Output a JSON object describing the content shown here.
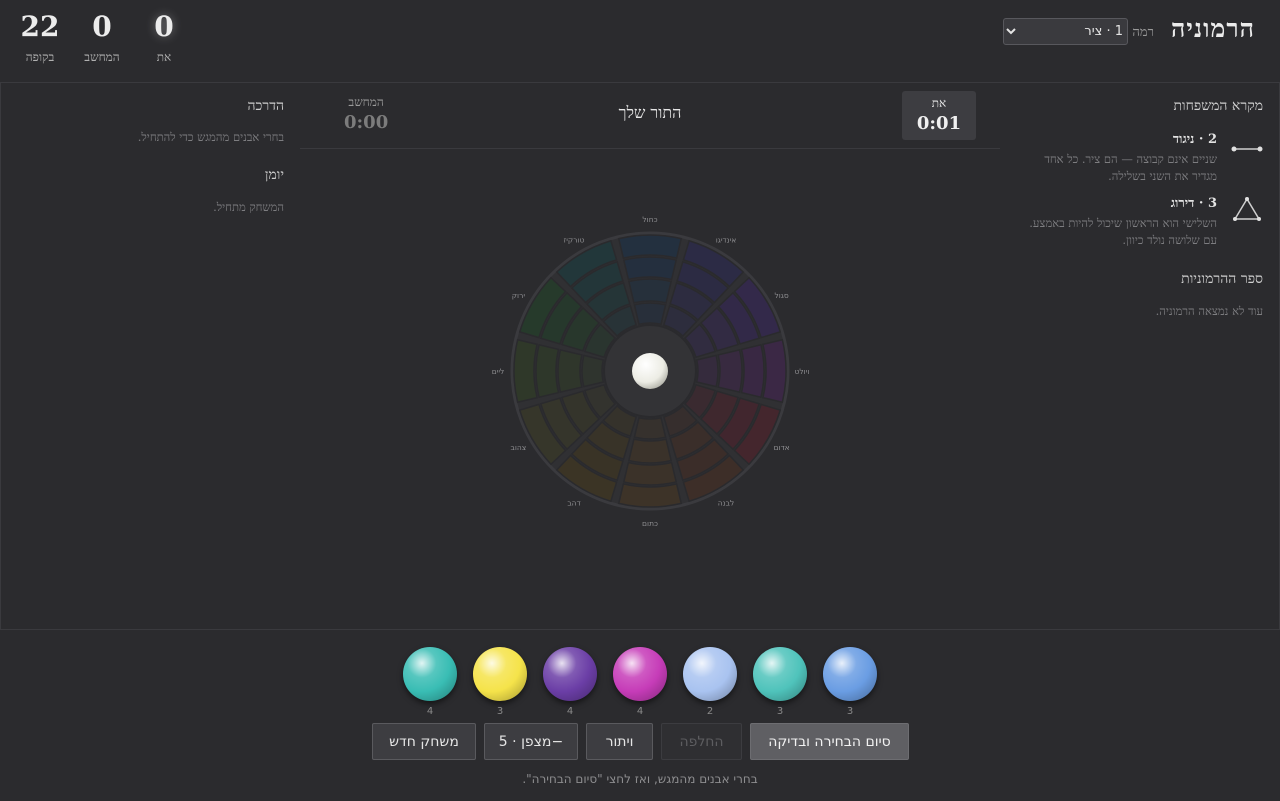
{
  "app": {
    "title": "הרמוניה",
    "level_label": "רמה",
    "level_value": "1 · ציר"
  },
  "scores": [
    {
      "value": "0",
      "label": "את"
    },
    {
      "value": "0",
      "label": "המחשב"
    },
    {
      "value": "22",
      "label": "בקופה"
    }
  ],
  "families": {
    "title": "מקרא המשפחות",
    "items": [
      {
        "name": "2 · ניגוד",
        "desc": "שניים אינם קבוצה — הם ציר. כל אחד מגדיר את השני בשלילה.",
        "icon": "line-pair-icon"
      },
      {
        "name": "3 · דירוג",
        "desc": "השלישי הוא הראשון שיכול להיות באמצע. עם שלושה נולד כיוון.",
        "icon": "triangle-icon"
      }
    ],
    "book_title": "ספר ההרמוניות",
    "book_empty": "עוד לא נמצאה הרמוניה."
  },
  "guide": {
    "title": "הדרכה",
    "text": "בחרי אבנים מהמגש כדי להתחיל.",
    "log_title": "יומן",
    "log_text": "המשחק מתחיל."
  },
  "turn": {
    "player_label": "את",
    "player_time": "0:01",
    "text": "התור שלך",
    "cpu_label": "המחשב",
    "cpu_time": "0:00"
  },
  "wheel": {
    "labels": [
      "כחול",
      "אינדיגו",
      "סגול",
      "ויולט",
      "אדום",
      "לבנה",
      "כתום",
      "דהב",
      "צהוב",
      "ליים",
      "ירוק",
      "טורקיז"
    ],
    "colors": [
      "#23303f",
      "#2c2b45",
      "#33294a",
      "#3b2845",
      "#44262d",
      "#3d2e28",
      "#3d3328",
      "#3b3425",
      "#36362a",
      "#2f3829",
      "#263a2b",
      "#22373a"
    ]
  },
  "tray": {
    "gems": [
      {
        "color": "#39bdb4",
        "count": "4",
        "name": "teal"
      },
      {
        "color": "#f5e34a",
        "count": "3",
        "name": "yellow"
      },
      {
        "color": "#6b3ea6",
        "count": "4",
        "name": "purple"
      },
      {
        "color": "#c63cb8",
        "count": "4",
        "name": "magenta"
      },
      {
        "color": "#a9c3f0",
        "count": "2",
        "name": "periwinkle"
      },
      {
        "color": "#4fc3bb",
        "count": "3",
        "name": "aqua"
      },
      {
        "color": "#6a9de3",
        "count": "3",
        "name": "blue"
      }
    ],
    "buttons": {
      "finish": "סיום הבחירה ובדיקה",
      "swap": "החלפה",
      "pass": "ויתור",
      "hint": "מצפן · 5−",
      "new_game": "משחק חדש"
    },
    "hint_text": "בחרי אבנים מהמגש, ואז לחצי \"סיום הבחירה\"."
  }
}
